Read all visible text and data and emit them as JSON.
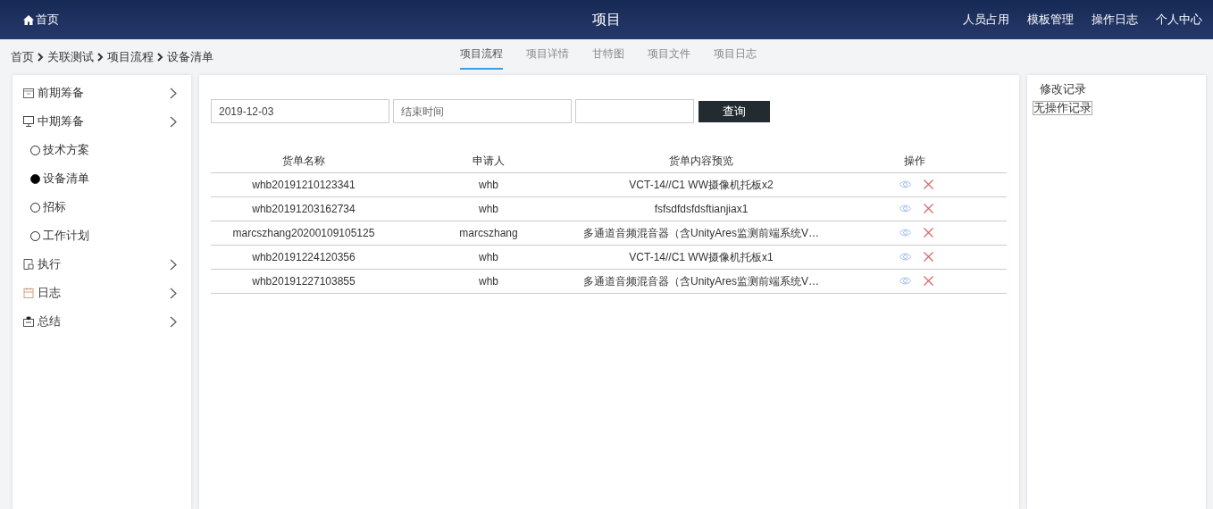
{
  "header": {
    "home": "首页",
    "title": "项目",
    "nav": [
      "人员占用",
      "模板管理",
      "操作日志",
      "个人中心"
    ]
  },
  "breadcrumb": [
    "首页",
    "关联测试",
    "项目流程",
    "设备清单"
  ],
  "tabs": [
    {
      "label": "项目流程",
      "selected": true
    },
    {
      "label": "项目详情",
      "selected": false
    },
    {
      "label": "甘特图",
      "selected": false
    },
    {
      "label": "项目文件",
      "selected": false
    },
    {
      "label": "项目日志",
      "selected": false
    }
  ],
  "sidebar": {
    "items": [
      {
        "label": "前期筹备"
      },
      {
        "label": "中期筹备",
        "children": [
          {
            "label": "技术方案",
            "selected": false
          },
          {
            "label": "设备清单",
            "selected": true
          },
          {
            "label": "招标",
            "selected": false
          },
          {
            "label": "工作计划",
            "selected": false
          }
        ]
      },
      {
        "label": "执行"
      },
      {
        "label": "日志"
      },
      {
        "label": "总结"
      }
    ]
  },
  "filters": {
    "start_date": "2019-12-03",
    "end_date_placeholder": "结束时间",
    "search_button": "查询"
  },
  "table": {
    "columns": [
      "货单名称",
      "申请人",
      "货单内容预览",
      "操作"
    ],
    "rows": [
      {
        "name": "whb20191210123341",
        "applicant": "whb",
        "preview": "VCT-14//C1 WW摄像机托板x2"
      },
      {
        "name": "whb20191203162734",
        "applicant": "whb",
        "preview": "fsfsdfdsfdsftianjiax1"
      },
      {
        "name": "marcszhang20200109105125",
        "applicant": "marcszhang",
        "preview": "多通道音频混音器（含UnityAres监测前端系统V…"
      },
      {
        "name": "whb20191224120356",
        "applicant": "whb",
        "preview": "VCT-14//C1 WW摄像机托板x1"
      },
      {
        "name": "whb20191227103855",
        "applicant": "whb",
        "preview": "多通道音频混音器（含UnityAres监测前端系统V…"
      }
    ]
  },
  "log_panel": {
    "title": "修改记录",
    "empty": "无操作记录"
  }
}
